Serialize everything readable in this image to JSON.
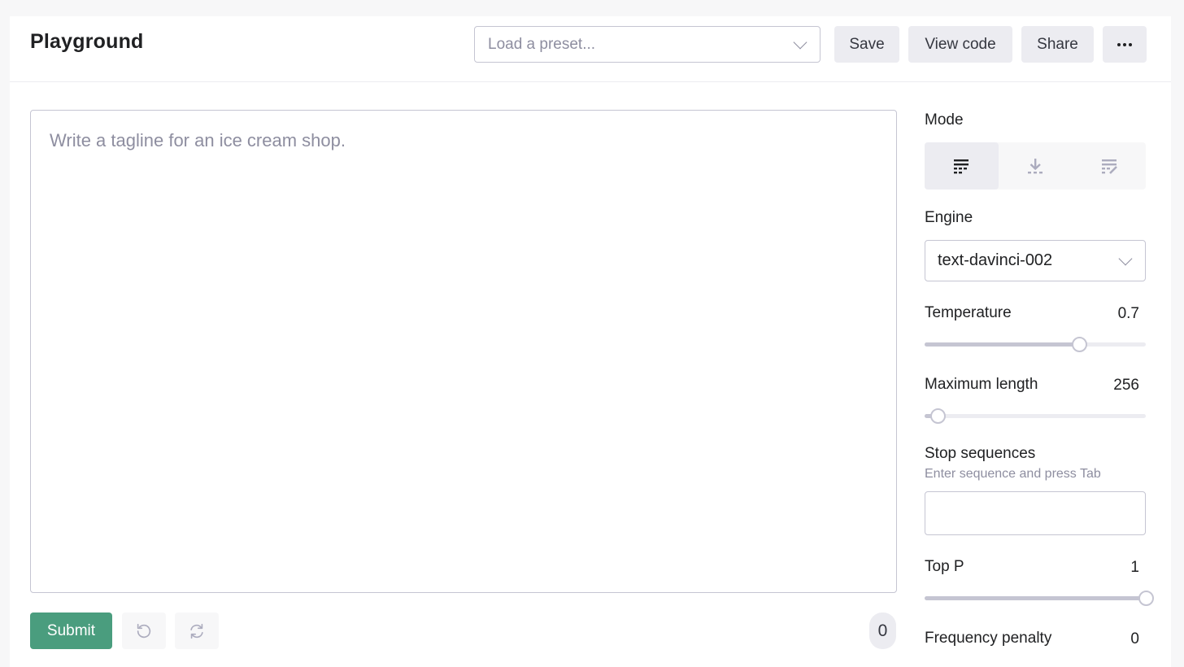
{
  "header": {
    "title": "Playground",
    "preset_placeholder": "Load a preset...",
    "buttons": {
      "save": "Save",
      "view_code": "View code",
      "share": "Share",
      "more": "more-options"
    }
  },
  "editor": {
    "placeholder": "Write a tagline for an ice cream shop.",
    "value": "",
    "submit_label": "Submit",
    "token_count": "0"
  },
  "settings": {
    "mode": {
      "label": "Mode",
      "options": [
        "complete",
        "insert",
        "edit"
      ],
      "selected": "complete"
    },
    "engine": {
      "label": "Engine",
      "value": "text-davinci-002"
    },
    "temperature": {
      "label": "Temperature",
      "value": "0.7",
      "fraction": 0.7
    },
    "max_length": {
      "label": "Maximum length",
      "value": "256",
      "fraction": 0.06
    },
    "stop_sequences": {
      "label": "Stop sequences",
      "hint": "Enter sequence and press Tab",
      "value": ""
    },
    "top_p": {
      "label": "Top P",
      "value": "1",
      "fraction": 1.0
    },
    "frequency_penalty": {
      "label": "Frequency penalty",
      "value": "0"
    }
  },
  "colors": {
    "accent": "#4a9d7e",
    "border": "#c5c5d2",
    "button_bg": "#ececf1",
    "muted_text": "#8e8ea0"
  }
}
